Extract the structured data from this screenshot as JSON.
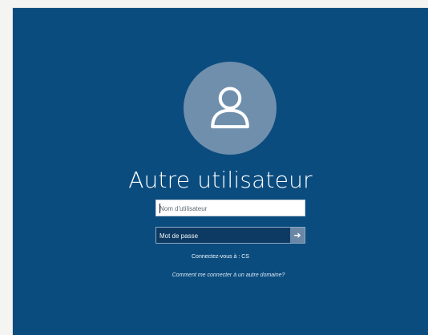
{
  "login": {
    "user_title": "Autre utilisateur",
    "username_placeholder": "Nom d'utilisateur",
    "password_placeholder": "Mot de passe",
    "connect_text": "Connectez-vous à : CS",
    "help_text": "Comment me connecter à un autre domaine?"
  },
  "icons": {
    "avatar": "user-icon",
    "submit": "arrow-right-icon"
  },
  "colors": {
    "background": "#0b4c7f",
    "avatar": "#6f8fad",
    "password_field": "#0d3a63",
    "submit_button": "#6a87a6"
  }
}
